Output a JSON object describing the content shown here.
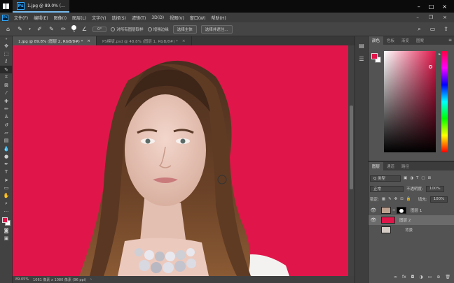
{
  "taskbar": {
    "ps_label": "Ps",
    "window_title": "1.jpg @ 89.0% (..."
  },
  "menubar": {
    "logo": "Ps",
    "items": [
      "文件(F)",
      "编辑(E)",
      "图像(I)",
      "图层(L)",
      "文字(Y)",
      "选择(S)",
      "滤镜(T)",
      "3D(D)",
      "视图(V)",
      "窗口(W)",
      "帮助(H)"
    ]
  },
  "options": {
    "brush_size": "5",
    "angle": "0°",
    "sample_all_layers": "对所有图层取样",
    "auto_enhance": "增强边缘",
    "select_subject": "选择主体",
    "select_and_mask": "选择并遮住..."
  },
  "tabs": [
    {
      "label": "1.jpg @ 89.8% (图层 2, RGB/8#) *",
      "close": "×"
    },
    {
      "label": "PS模版.psd @ 48.8% (图层 1, RGB/8#) *",
      "close": "×"
    }
  ],
  "status": {
    "zoom": "89.05%",
    "doc": "1061 像素 x 1080 像素 (96 ppi)"
  },
  "color_panel": {
    "tabs": [
      "颜色",
      "色板",
      "渐变",
      "图案"
    ],
    "foreground": "#e0164a",
    "background": "#ffffff",
    "hue_top": "#c8184f"
  },
  "layers_panel": {
    "tabs": [
      "图层",
      "通道",
      "路径"
    ],
    "filter_kind": "Q 类型",
    "blend_mode": "正常",
    "opacity_label": "不透明度:",
    "opacity_value": "100%",
    "lock_label": "锁定:",
    "fill_label": "填充:",
    "fill_value": "100%",
    "layers": [
      {
        "name": "图层 1",
        "visible": true,
        "selected": false,
        "mask": true
      },
      {
        "name": "图层 2",
        "visible": true,
        "selected": true,
        "mask": false
      },
      {
        "name": "背景",
        "visible": false,
        "selected": false,
        "mask": false
      }
    ]
  }
}
